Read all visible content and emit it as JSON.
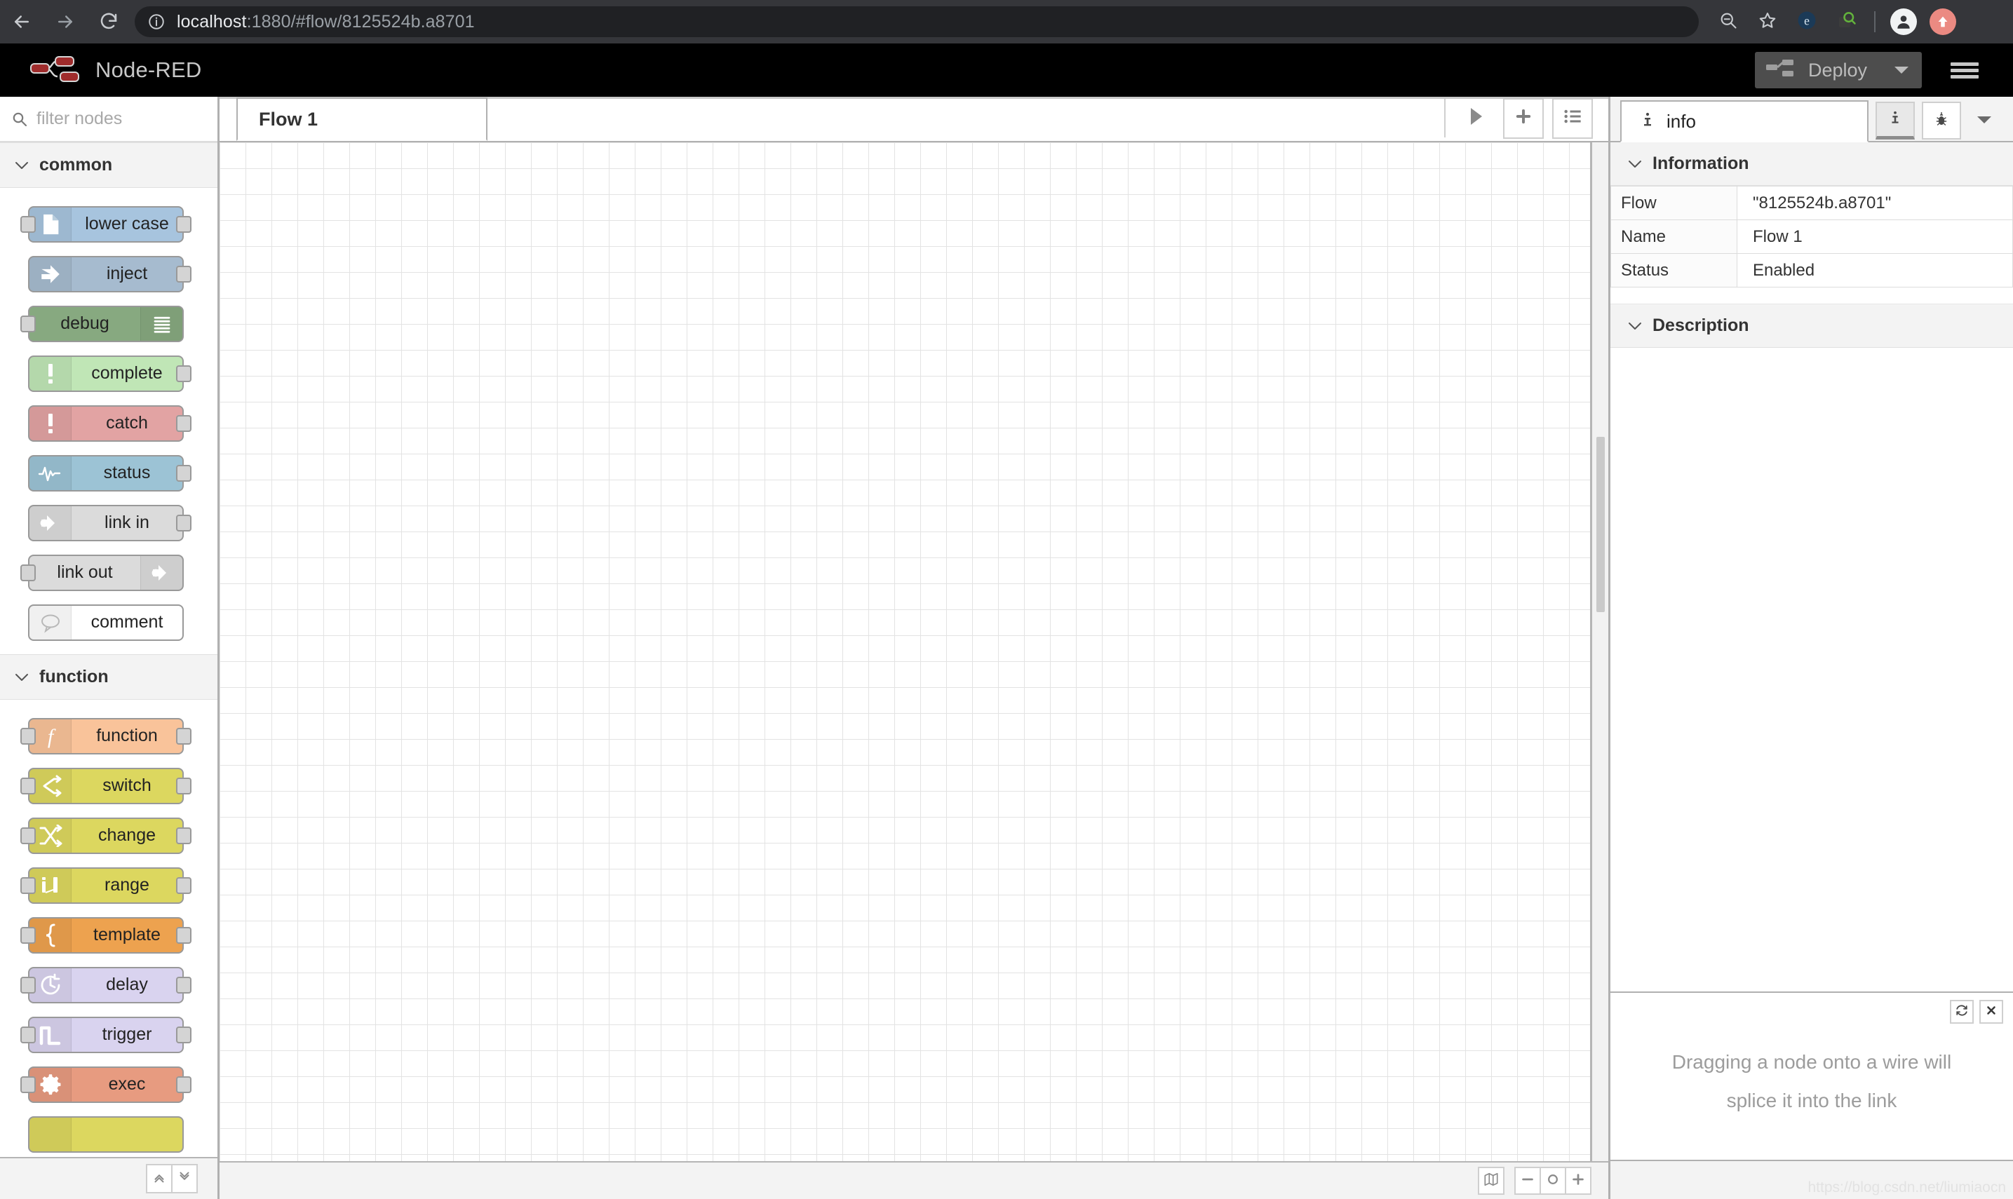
{
  "browser": {
    "back_icon": "back-arrow-icon",
    "forward_icon": "forward-arrow-icon",
    "reload_icon": "reload-icon",
    "site_info_icon": "site-info-icon",
    "url_host": "localhost",
    "url_rest": ":1880/#flow/8125524b.a8701",
    "zoom_out_icon": "zoom-out-icon",
    "bookmark_icon": "star-icon",
    "ext_shield_icon": "extension-shield-icon",
    "ext_search_icon": "extension-search-icon",
    "profile_icon": "profile-avatar-icon",
    "update_icon": "update-arrow-icon"
  },
  "app": {
    "logo_icon": "node-red-logo-icon",
    "title": "Node-RED",
    "deploy_label": "Deploy",
    "deploy_icon": "deploy-icon",
    "deploy_caret_icon": "chevron-down-icon",
    "menu_icon": "hamburger-menu-icon"
  },
  "palette": {
    "search_placeholder": "filter nodes",
    "search_value": "",
    "search_icon": "search-icon",
    "categories": [
      {
        "name": "common",
        "caret_icon": "chevron-down-icon",
        "nodes": [
          {
            "label": "lower case",
            "icon": "file-icon",
            "color": "#a7c4de",
            "icon_side": "left",
            "inputs": 1,
            "outputs": 1
          },
          {
            "label": "inject",
            "icon": "inject-icon",
            "color": "#a6bbcf",
            "icon_side": "left",
            "inputs": 0,
            "outputs": 1
          },
          {
            "label": "debug",
            "icon": "debug-icon",
            "color": "#87a980",
            "icon_side": "right",
            "inputs": 1,
            "outputs": 0
          },
          {
            "label": "complete",
            "icon": "alert-icon",
            "color": "#c0e6b6",
            "icon_side": "left",
            "inputs": 0,
            "outputs": 1
          },
          {
            "label": "catch",
            "icon": "alert-icon",
            "color": "#e2a3a3",
            "icon_side": "left",
            "inputs": 0,
            "outputs": 1
          },
          {
            "label": "status",
            "icon": "pulse-icon",
            "color": "#9cc3d5",
            "icon_side": "left",
            "inputs": 0,
            "outputs": 1
          },
          {
            "label": "link in",
            "icon": "link-icon",
            "color": "#dbdbdb",
            "icon_side": "left",
            "inputs": 0,
            "outputs": 1
          },
          {
            "label": "link out",
            "icon": "link-icon",
            "color": "#dbdbdb",
            "icon_side": "right",
            "inputs": 1,
            "outputs": 0
          },
          {
            "label": "comment",
            "icon": "comment-icon",
            "color": "#ffffff",
            "icon_side": "left",
            "inputs": 0,
            "outputs": 0
          }
        ]
      },
      {
        "name": "function",
        "caret_icon": "chevron-down-icon",
        "nodes": [
          {
            "label": "function",
            "icon": "function-icon",
            "color": "#f9c39a",
            "icon_side": "left",
            "inputs": 1,
            "outputs": 1
          },
          {
            "label": "switch",
            "icon": "switch-icon",
            "color": "#dcd75f",
            "icon_side": "left",
            "inputs": 1,
            "outputs": 1
          },
          {
            "label": "change",
            "icon": "change-icon",
            "color": "#dcd75f",
            "icon_side": "left",
            "inputs": 1,
            "outputs": 1
          },
          {
            "label": "range",
            "icon": "range-icon",
            "color": "#dcd75f",
            "icon_side": "left",
            "inputs": 1,
            "outputs": 1
          },
          {
            "label": "template",
            "icon": "brace-icon",
            "color": "#eda24f",
            "icon_side": "left",
            "inputs": 1,
            "outputs": 1
          },
          {
            "label": "delay",
            "icon": "clock-icon",
            "color": "#d9d3ef",
            "icon_side": "left",
            "inputs": 1,
            "outputs": 1
          },
          {
            "label": "trigger",
            "icon": "pulse-step-icon",
            "color": "#d9d3ef",
            "icon_side": "left",
            "inputs": 1,
            "outputs": 1
          },
          {
            "label": "exec",
            "icon": "gear-icon",
            "color": "#e79b80",
            "icon_side": "left",
            "inputs": 1,
            "outputs": 1
          },
          {
            "label": "",
            "icon": "",
            "color": "#dcd75f",
            "icon_side": "left",
            "inputs": 0,
            "outputs": 0
          }
        ]
      }
    ],
    "footer": {
      "collapse_all_icon": "chevrons-up-icon",
      "expand_all_icon": "chevrons-down-icon"
    }
  },
  "workspace": {
    "tabs": [
      {
        "label": "Flow 1",
        "active": true
      }
    ],
    "actions": {
      "play_icon": "play-triangle-icon",
      "add_tab_icon": "plus-icon",
      "list_tabs_icon": "list-icon"
    },
    "footer": {
      "navigator_icon": "map-icon",
      "zoom_out_icon": "minus-icon",
      "zoom_reset_icon": "circle-icon",
      "zoom_in_icon": "plus-icon"
    }
  },
  "sidebar": {
    "tab": {
      "icon": "info-icon",
      "label": "info"
    },
    "actions": {
      "info_icon": "info-icon",
      "debug_icon": "bug-icon",
      "more_icon": "chevron-down-icon"
    },
    "information": {
      "section_title": "Information",
      "caret_icon": "chevron-down-icon",
      "rows": [
        {
          "key": "Flow",
          "value": "\"8125524b.a8701\"",
          "value_color": "#b32323"
        },
        {
          "key": "Name",
          "value": "Flow 1",
          "value_color": "#333333"
        },
        {
          "key": "Status",
          "value": "Enabled",
          "value_color": "#333333"
        }
      ]
    },
    "description": {
      "section_title": "Description",
      "caret_icon": "chevron-down-icon",
      "body": ""
    },
    "tip": {
      "line1": "Dragging a node onto a wire will",
      "line2": "splice it into the link",
      "refresh_icon": "refresh-icon",
      "close_icon": "close-icon"
    }
  },
  "watermark": "https://blog.csdn.net/liumiaocn"
}
